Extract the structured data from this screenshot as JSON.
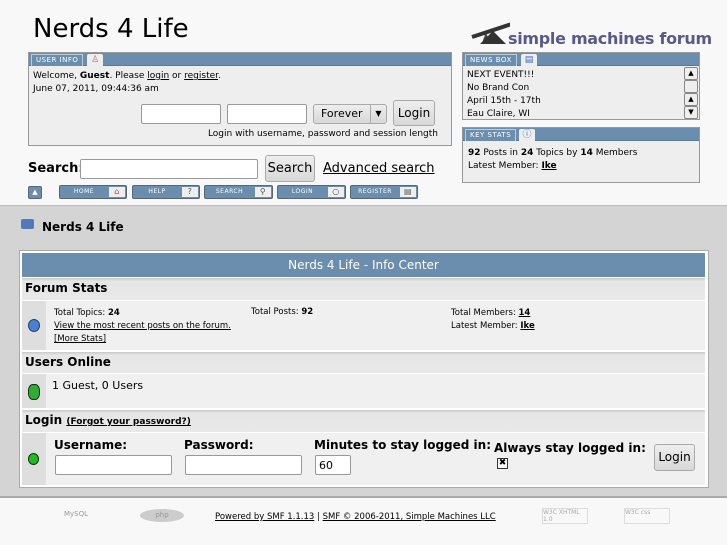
{
  "site_title": "Nerds 4 Life",
  "logo_text": "simple machines forum",
  "user_info": {
    "tab": "USER INFO",
    "welcome_prefix": "Welcome, ",
    "guest": "Guest",
    "please": ". Please ",
    "login_link": "login",
    "or": " or ",
    "register_link": "register",
    "end": ".",
    "datetime": "June 07, 2011, 09:44:36 am",
    "session_select": "Forever",
    "login_button": "Login",
    "hint": "Login with username, password and session length"
  },
  "search": {
    "label": "Search:",
    "button": "Search",
    "advanced": "Advanced search"
  },
  "nav": [
    "HOME",
    "HELP",
    "SEARCH",
    "LOGIN",
    "REGISTER"
  ],
  "news_box": {
    "tab": "NEWS BOX",
    "lines": [
      "NEXT EVENT!!!",
      "No Brand Con",
      "April 15th - 17th",
      "Eau Claire, WI"
    ]
  },
  "key_stats": {
    "tab": "KEY STATS",
    "posts": "92",
    "posts_label": " Posts in ",
    "topics": "24",
    "topics_label": " Topics by ",
    "members": "14",
    "members_label": " Members",
    "latest_label": "Latest Member: ",
    "latest": "Ike"
  },
  "breadcrumb": "Nerds 4 Life",
  "info_center": {
    "title": "Nerds 4 Life - Info Center",
    "forum_stats": {
      "heading": "Forum Stats",
      "total_topics_label": "Total Topics: ",
      "total_topics": "24",
      "recent_link": "View the most recent posts on the forum.",
      "more_stats": "[More Stats]",
      "total_posts_label": "Total Posts: ",
      "total_posts": "92",
      "total_members_label": "Total Members: ",
      "total_members": "14",
      "latest_label": "Latest Member: ",
      "latest": "Ike"
    },
    "users_online": {
      "heading": "Users Online",
      "text": "1 Guest, 0 Users"
    },
    "login": {
      "heading": "Login",
      "forgot": "(Forgot your password?)",
      "username_label": "Username:",
      "password_label": "Password:",
      "minutes_label": "Minutes to stay logged in:",
      "minutes_value": "60",
      "always_label": "Always stay logged in:",
      "always_checked": true,
      "button": "Login"
    }
  },
  "footer": {
    "powered": "Powered by SMF 1.1.13",
    "sep": " | ",
    "copyright": "SMF © 2006-2011, Simple Machines LLC",
    "badges": [
      "MySQL",
      "php",
      "W3C XHTML 1.0",
      "W3C css"
    ]
  },
  "colors": {
    "bar": "#6b8eae",
    "band": "#d4d4d4"
  }
}
